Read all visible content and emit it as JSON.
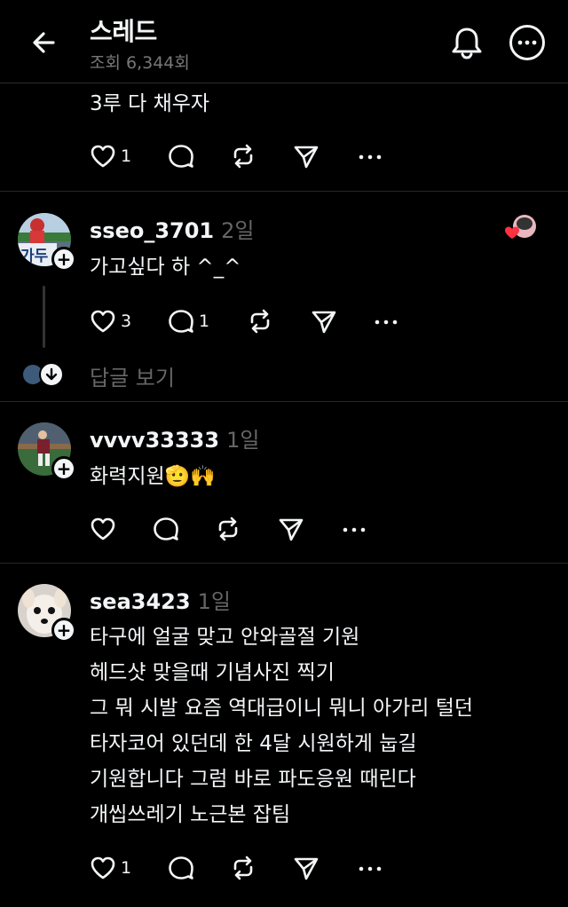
{
  "header": {
    "title": "스레드",
    "views": "조회 6,344회"
  },
  "top_reply": {
    "text": "3루 다 채우자",
    "like_count": "1"
  },
  "posts": [
    {
      "username": "sseo_3701",
      "time": "2일",
      "text": "가고싶다 하 ^_^",
      "like_count": "3",
      "reply_count": "1",
      "view_replies": "답글 보기",
      "avatar_badge": "가두"
    },
    {
      "username": "vvvv33333",
      "time": "1일",
      "text": "화력지원🫡🙌"
    },
    {
      "username": "sea3423",
      "time": "1일",
      "lines": [
        "타구에 얼굴 맞고 안와골절 기원",
        "헤드샷 맞을때 기념사진 찍기",
        "그 뭐 시발 요즘 역대급이니 뭐니 아가리 털던",
        "타자코어 있던데 한 4달 시원하게 눕길",
        "기원합니다 그럼 바로 파도응원 때린다",
        "개씹쓰레기 노근본 잡팀"
      ],
      "like_count": "1"
    }
  ],
  "icons": {
    "back": "arrow-left-icon",
    "bell": "bell-icon",
    "more": "more-circle-icon",
    "like": "heart-icon",
    "reply": "comment-icon",
    "repost": "repost-icon",
    "share": "send-icon",
    "menu": "ellipsis-icon"
  },
  "colors": {
    "background": "#000000",
    "text": "#f3f5f7",
    "muted": "#777777",
    "like_red": "#ff3040"
  }
}
